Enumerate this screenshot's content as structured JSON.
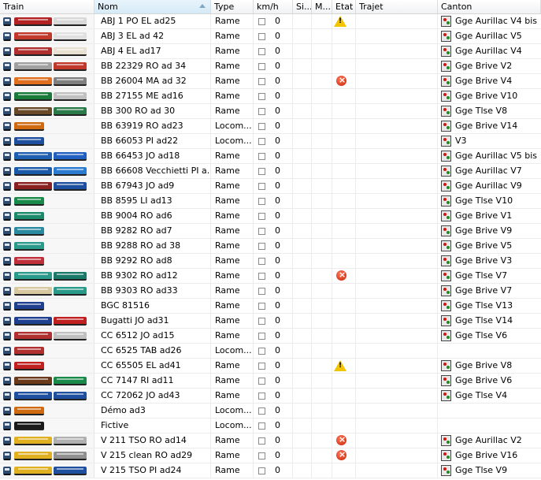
{
  "colors": {
    "warning": "#f2c500",
    "error": "#c81e00",
    "signal_red": "#d4140c",
    "signal_green": "#1e8a1e",
    "header_bg": "#f1f2f4",
    "row_border": "#ececec"
  },
  "columns": {
    "train": "Train",
    "nom": "Nom",
    "type": "Type",
    "kmh": "km/h",
    "si": "Si...",
    "m": "M...",
    "etat": "Etat",
    "trajet": "Trajet",
    "canton": "Canton"
  },
  "rows": [
    {
      "nom": "ABJ 1 PO EL ad25",
      "type": "Rame",
      "speed": "0",
      "etat": "warning",
      "canton": "Gge Aurillac V4 bis",
      "icon": "railcar-icon",
      "colors": [
        "#b22222",
        "#d8d8d8"
      ]
    },
    {
      "nom": "ABJ 3 EL ad 42",
      "type": "Rame",
      "speed": "0",
      "etat": "",
      "canton": "Gge Aurillac V5",
      "icon": "railcar-icon",
      "colors": [
        "#c0392b",
        "#e0e0e0"
      ]
    },
    {
      "nom": "ABJ 4 EL ad17",
      "type": "Rame",
      "speed": "0",
      "etat": "",
      "canton": "Gge Aurillac V4",
      "icon": "railcar-icon",
      "colors": [
        "#b03030",
        "#e8e0d0"
      ]
    },
    {
      "nom": "BB 22329 RO ad 34",
      "type": "Rame",
      "speed": "0",
      "etat": "",
      "canton": "Gge Brive V2",
      "icon": "locomotive-icon",
      "colors": [
        "#a0a0a0",
        "#c0392b"
      ]
    },
    {
      "nom": "BB 26004 MA ad 32",
      "type": "Rame",
      "speed": "0",
      "etat": "error",
      "canton": "Gge Brive V4",
      "icon": "locomotive-icon",
      "colors": [
        "#e07020",
        "#808080"
      ]
    },
    {
      "nom": "BB 27155 ME ad16",
      "type": "Rame",
      "speed": "0",
      "etat": "",
      "canton": "Gge Brive V10",
      "icon": "locomotive-icon",
      "colors": [
        "#1a7a3a",
        "#c0c0c0"
      ]
    },
    {
      "nom": "BB 300 RO ad 30",
      "type": "Rame",
      "speed": "0",
      "etat": "",
      "canton": "Gge Tlse V8",
      "icon": "locomotive-icon",
      "colors": [
        "#6b4a2a",
        "#2a7a4a"
      ]
    },
    {
      "nom": "BB 63919 RO ad23",
      "type": "Locom...",
      "speed": "0",
      "etat": "",
      "canton": "Gge Brive V14",
      "icon": "locomotive-icon",
      "colors": [
        "#d06a10"
      ]
    },
    {
      "nom": "BB 66053 PI ad22",
      "type": "Locom...",
      "speed": "0",
      "etat": "",
      "canton": "V3",
      "icon": "locomotive-icon",
      "colors": [
        "#1f4f9f"
      ]
    },
    {
      "nom": "BB 66453 JO ad18",
      "type": "Rame",
      "speed": "0",
      "etat": "",
      "canton": "Gge Aurillac V5 bis",
      "icon": "locomotive-icon",
      "colors": [
        "#1f5faf",
        "#2060c0"
      ]
    },
    {
      "nom": "BB 66608 Vecchietti PI a...",
      "type": "Rame",
      "speed": "0",
      "etat": "",
      "canton": "Gge Aurillac V7",
      "icon": "locomotive-icon",
      "colors": [
        "#1a5aa8",
        "#2b7bd0"
      ]
    },
    {
      "nom": "BB 67943 JO ad9",
      "type": "Rame",
      "speed": "0",
      "etat": "",
      "canton": "Gge Aurillac V9",
      "icon": "locomotive-icon",
      "colors": [
        "#8b2020",
        "#1f4f9f"
      ]
    },
    {
      "nom": "BB 8595 LI ad13",
      "type": "Rame",
      "speed": "0",
      "etat": "",
      "canton": "Gge Tlse V10",
      "icon": "locomotive-icon",
      "colors": [
        "#1a8a4a"
      ]
    },
    {
      "nom": "BB 9004 RO ad6",
      "type": "Rame",
      "speed": "0",
      "etat": "",
      "canton": "Gge Brive V1",
      "icon": "locomotive-icon",
      "colors": [
        "#1a8a6a"
      ]
    },
    {
      "nom": "BB 9282 RO ad7",
      "type": "Rame",
      "speed": "0",
      "etat": "",
      "canton": "Gge Brive V9",
      "icon": "locomotive-icon",
      "colors": [
        "#2a8aa0"
      ]
    },
    {
      "nom": "BB 9288 RO ad 38",
      "type": "Rame",
      "speed": "0",
      "etat": "",
      "canton": "Gge Brive V5",
      "icon": "locomotive-icon",
      "colors": [
        "#2a9a8a"
      ]
    },
    {
      "nom": "BB 9292 RO ad8",
      "type": "Rame",
      "speed": "0",
      "etat": "",
      "canton": "Gge Brive V3",
      "icon": "locomotive-icon",
      "colors": [
        "#c0303a"
      ]
    },
    {
      "nom": "BB 9302 RO ad12",
      "type": "Rame",
      "speed": "0",
      "etat": "error",
      "canton": "Gge Tlse V7",
      "icon": "locomotive-icon",
      "colors": [
        "#2a9a8a",
        "#1a7a6a"
      ]
    },
    {
      "nom": "BB 9303 RO ad33",
      "type": "Rame",
      "speed": "0",
      "etat": "",
      "canton": "Gge Brive V7",
      "icon": "locomotive-icon",
      "colors": [
        "#d8c8a0",
        "#2a9a8a"
      ]
    },
    {
      "nom": "BGC 81516",
      "type": "Rame",
      "speed": "0",
      "etat": "",
      "canton": "Gge Tlse V13",
      "icon": "railcar-icon",
      "colors": [
        "#1f3f8f"
      ]
    },
    {
      "nom": "Bugatti JO ad31",
      "type": "Rame",
      "speed": "0",
      "etat": "",
      "canton": "Gge Tlse V14",
      "icon": "railcar-icon",
      "colors": [
        "#1f3f8f",
        "#c02020"
      ]
    },
    {
      "nom": "CC 6512 JO ad15",
      "type": "Rame",
      "speed": "0",
      "etat": "",
      "canton": "Gge Tlse V6",
      "icon": "locomotive-icon",
      "colors": [
        "#b03030",
        "#c0c0c0"
      ]
    },
    {
      "nom": "CC 6525 TAB ad26",
      "type": "Locom...",
      "speed": "0",
      "etat": "",
      "canton": "",
      "icon": "locomotive-icon",
      "colors": [
        "#b03030"
      ]
    },
    {
      "nom": "CC 65505 EL ad41",
      "type": "Rame",
      "speed": "0",
      "etat": "warning",
      "canton": "Gge Brive V8",
      "icon": "locomotive-icon",
      "colors": [
        "#c02020"
      ]
    },
    {
      "nom": "CC 7147 RI ad11",
      "type": "Rame",
      "speed": "0",
      "etat": "",
      "canton": "Gge Brive V6",
      "icon": "locomotive-icon",
      "colors": [
        "#6b3a1a",
        "#1a8a4a"
      ]
    },
    {
      "nom": "CC 72062 JO ad43",
      "type": "Rame",
      "speed": "0",
      "etat": "",
      "canton": "Gge Tlse V4",
      "icon": "locomotive-icon",
      "colors": [
        "#1f4f9f",
        "#1f4f9f"
      ]
    },
    {
      "nom": "Démo ad3",
      "type": "Locom...",
      "speed": "0",
      "etat": "",
      "canton": "",
      "icon": "locomotive-icon",
      "colors": [
        "#d06a10"
      ]
    },
    {
      "nom": "Fictive",
      "type": "Locom...",
      "speed": "0",
      "etat": "",
      "canton": "",
      "icon": "steam-locomotive-icon",
      "colors": [
        "#1a1a1a"
      ]
    },
    {
      "nom": "V 211 TSO RO ad14",
      "type": "Rame",
      "speed": "0",
      "etat": "error",
      "canton": "Gge Aurillac V2",
      "icon": "locomotive-icon",
      "colors": [
        "#e0b020",
        "#b0b0b0"
      ]
    },
    {
      "nom": "V 215 clean RO ad29",
      "type": "Rame",
      "speed": "0",
      "etat": "error",
      "canton": "Gge Brive V16",
      "icon": "locomotive-icon",
      "colors": [
        "#e0b020",
        "#909090"
      ]
    },
    {
      "nom": "V 215 TSO PI ad24",
      "type": "Rame",
      "speed": "0",
      "etat": "",
      "canton": "Gge Tlse V9",
      "icon": "locomotive-icon",
      "colors": [
        "#e0b020",
        "#1f4f9f"
      ]
    }
  ]
}
